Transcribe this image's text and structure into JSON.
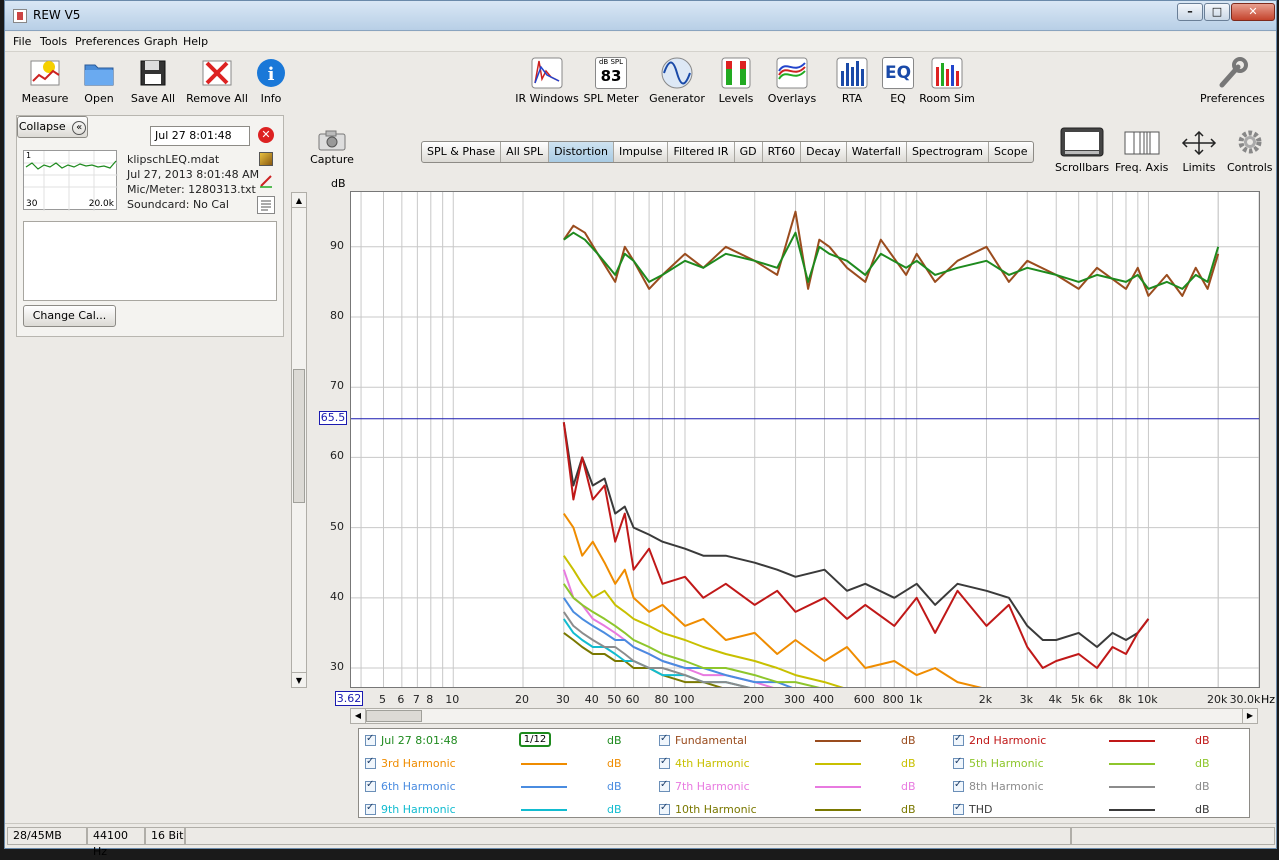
{
  "window": {
    "title": "REW V5"
  },
  "menu": [
    "File",
    "Tools",
    "Preferences",
    "Graph",
    "Help"
  ],
  "toolbar_left": [
    {
      "label": "Measure",
      "icon": "measure-icon"
    },
    {
      "label": "Open",
      "icon": "folder-icon"
    },
    {
      "label": "Save All",
      "icon": "save-icon"
    },
    {
      "label": "Remove All",
      "icon": "remove-icon"
    },
    {
      "label": "Info",
      "icon": "info-icon"
    }
  ],
  "toolbar_center": [
    {
      "label": "IR Windows",
      "icon": "ir-windows-icon"
    },
    {
      "label": "SPL Meter",
      "icon": "spl-meter-icon",
      "small": "dB SPL",
      "value": "83"
    },
    {
      "label": "Generator",
      "icon": "generator-icon"
    },
    {
      "label": "Levels",
      "icon": "levels-icon"
    },
    {
      "label": "Overlays",
      "icon": "overlays-icon"
    },
    {
      "label": "RTA",
      "icon": "rta-icon"
    },
    {
      "label": "EQ",
      "icon": "eq-icon",
      "badge": "EQ"
    },
    {
      "label": "Room Sim",
      "icon": "room-sim-icon"
    }
  ],
  "toolbar_right": {
    "label": "Preferences",
    "icon": "wrench-icon"
  },
  "panel": {
    "collapse_label": "Collapse",
    "selected_measurement": "Jul 27 8:01:48",
    "thumb_x_min": "30",
    "thumb_x_max": "20.0k",
    "thumb_marker": "1",
    "file": "klipschLEQ.mdat",
    "date": "Jul 27, 2013 8:01:48 AM",
    "mic": "Mic/Meter: 1280313.txt",
    "soundcard": "Soundcard: No Cal",
    "change_cal": "Change Cal..."
  },
  "capture_label": "Capture",
  "tabs": [
    "SPL & Phase",
    "All SPL",
    "Distortion",
    "Impulse",
    "Filtered IR",
    "GD",
    "RT60",
    "Decay",
    "Waterfall",
    "Spectrogram",
    "Scope"
  ],
  "active_tab": "Distortion",
  "right_tools": [
    {
      "label": "Scrollbars",
      "icon": "scrollbars-icon"
    },
    {
      "label": "Freq. Axis",
      "icon": "freq-axis-icon"
    },
    {
      "label": "Limits",
      "icon": "limits-icon"
    },
    {
      "label": "Controls",
      "icon": "gear-icon"
    }
  ],
  "chart_data": {
    "type": "line",
    "ylabel": "dB",
    "xunit": "Hz",
    "xscale": "log",
    "xlim": [
      3.62,
      30000
    ],
    "ylim": [
      27.3,
      97.8
    ],
    "y_ticks": [
      "90",
      "80",
      "70",
      "60",
      "50",
      "40",
      "30"
    ],
    "x_ticks": [
      "5",
      "6",
      "7",
      "8",
      "10",
      "20",
      "30",
      "40",
      "50",
      "60",
      "80",
      "100",
      "200",
      "300",
      "400",
      "600",
      "800",
      "1k",
      "2k",
      "3k",
      "4k",
      "5k",
      "6k",
      "8k",
      "10k",
      "20k",
      "30.0k"
    ],
    "x_start_label": "3.62",
    "cursor_y_label": "65.5",
    "cursor_y": 65.5,
    "grid": true,
    "series": [
      {
        "name": "Jul 27 8:01:48",
        "color": "#1e8a1e",
        "x": [
          30,
          33,
          37,
          42,
          50,
          55,
          60,
          70,
          80,
          100,
          120,
          150,
          200,
          250,
          300,
          340,
          380,
          420,
          500,
          600,
          700,
          900,
          1000,
          1200,
          1500,
          2000,
          2500,
          3000,
          4000,
          5000,
          6000,
          8000,
          9000,
          10000,
          12000,
          14000,
          16000,
          18000,
          20000
        ],
        "values": [
          91,
          92,
          91,
          89,
          86,
          89,
          88,
          85,
          86,
          88,
          87,
          89,
          88,
          87,
          92,
          85,
          90,
          89,
          88,
          86,
          89,
          87,
          88,
          86,
          87,
          88,
          86,
          87,
          86,
          85,
          86,
          85,
          86,
          84,
          85,
          84,
          86,
          85,
          90
        ]
      },
      {
        "name": "Fundamental",
        "color": "#9a4c1e",
        "x": [
          30,
          33,
          37,
          42,
          50,
          55,
          60,
          70,
          80,
          100,
          120,
          150,
          200,
          250,
          300,
          340,
          380,
          420,
          500,
          600,
          700,
          900,
          1000,
          1200,
          1500,
          2000,
          2500,
          3000,
          4000,
          5000,
          6000,
          8000,
          9000,
          10000,
          12000,
          14000,
          16000,
          18000,
          20000
        ],
        "values": [
          91,
          93,
          92,
          89,
          85,
          90,
          88,
          84,
          86,
          89,
          87,
          90,
          88,
          86,
          95,
          84,
          91,
          90,
          87,
          85,
          91,
          86,
          89,
          85,
          88,
          90,
          85,
          88,
          86,
          84,
          87,
          84,
          87,
          83,
          86,
          83,
          87,
          84,
          89
        ]
      },
      {
        "name": "2nd Harmonic",
        "color": "#c01818",
        "x": [
          30,
          33,
          36,
          40,
          45,
          50,
          55,
          60,
          70,
          80,
          100,
          120,
          150,
          200,
          250,
          300,
          400,
          500,
          600,
          800,
          1000,
          1200,
          1500,
          2000,
          2500,
          3000,
          3500,
          4000,
          5000,
          6000,
          7000,
          8000,
          9000,
          10000
        ],
        "values": [
          65,
          54,
          60,
          54,
          56,
          48,
          52,
          44,
          47,
          42,
          43,
          40,
          42,
          39,
          41,
          38,
          40,
          37,
          39,
          36,
          40,
          35,
          41,
          36,
          39,
          33,
          30,
          31,
          32,
          30,
          33,
          32,
          35,
          37
        ]
      },
      {
        "name": "3rd Harmonic",
        "color": "#ef8c00",
        "x": [
          30,
          33,
          36,
          40,
          45,
          50,
          55,
          60,
          70,
          80,
          100,
          120,
          150,
          200,
          250,
          300,
          400,
          500,
          600,
          800,
          1000,
          1200,
          1500,
          2000
        ],
        "values": [
          52,
          50,
          46,
          48,
          45,
          42,
          44,
          40,
          38,
          39,
          36,
          37,
          34,
          35,
          32,
          34,
          31,
          33,
          30,
          31,
          29,
          30,
          28,
          27
        ]
      },
      {
        "name": "4th Harmonic",
        "color": "#c8c000",
        "x": [
          30,
          33,
          36,
          40,
          45,
          50,
          55,
          60,
          70,
          80,
          100,
          120,
          150,
          200,
          250,
          300,
          400,
          500
        ],
        "values": [
          46,
          44,
          42,
          40,
          41,
          39,
          38,
          37,
          36,
          35,
          34,
          33,
          32,
          31,
          30,
          29,
          28,
          27
        ]
      },
      {
        "name": "5th Harmonic",
        "color": "#8ec62c",
        "x": [
          30,
          33,
          36,
          40,
          45,
          50,
          55,
          60,
          70,
          80,
          100,
          120,
          150,
          200,
          250,
          300,
          400
        ],
        "values": [
          42,
          40,
          39,
          38,
          37,
          36,
          35,
          34,
          33,
          32,
          31,
          30,
          30,
          29,
          28,
          28,
          27
        ]
      },
      {
        "name": "6th Harmonic",
        "color": "#4a8ce0",
        "x": [
          30,
          33,
          36,
          40,
          45,
          50,
          55,
          60,
          70,
          80,
          100,
          120,
          150,
          200,
          250,
          300
        ],
        "values": [
          40,
          38,
          37,
          36,
          35,
          34,
          34,
          33,
          32,
          31,
          30,
          30,
          29,
          28,
          28,
          27
        ]
      },
      {
        "name": "7th Harmonic",
        "color": "#e87ae0",
        "x": [
          30,
          33,
          36,
          40,
          45,
          50,
          55,
          60,
          70,
          80,
          100,
          120,
          150,
          200,
          250
        ],
        "values": [
          44,
          40,
          39,
          37,
          36,
          35,
          34,
          33,
          32,
          31,
          30,
          29,
          29,
          28,
          27
        ]
      },
      {
        "name": "8th Harmonic",
        "color": "#8c8c8c",
        "x": [
          30,
          33,
          36,
          40,
          45,
          50,
          55,
          60,
          70,
          80,
          100,
          120,
          150,
          200
        ],
        "values": [
          38,
          36,
          35,
          34,
          33,
          33,
          32,
          31,
          30,
          30,
          29,
          28,
          28,
          27
        ]
      },
      {
        "name": "9th Harmonic",
        "color": "#12bcd0",
        "x": [
          30,
          33,
          36,
          40,
          45,
          50,
          55,
          60,
          70,
          80,
          100,
          120,
          150,
          200
        ],
        "values": [
          37,
          35,
          34,
          33,
          33,
          32,
          31,
          31,
          30,
          29,
          29,
          28,
          28,
          27
        ]
      },
      {
        "name": "10th Harmonic",
        "color": "#7a7800",
        "x": [
          30,
          33,
          36,
          40,
          45,
          50,
          55,
          60,
          70,
          80,
          100,
          120,
          150
        ],
        "values": [
          35,
          34,
          33,
          32,
          32,
          31,
          31,
          30,
          30,
          29,
          28,
          28,
          27
        ]
      },
      {
        "name": "THD",
        "color": "#3a3a3a",
        "x": [
          30,
          33,
          36,
          40,
          45,
          50,
          55,
          60,
          70,
          80,
          100,
          120,
          150,
          200,
          250,
          300,
          400,
          500,
          600,
          800,
          1000,
          1200,
          1500,
          2000,
          2500,
          3000,
          3500,
          4000,
          5000,
          6000,
          7000,
          8000,
          9000,
          10000
        ],
        "values": [
          65,
          56,
          60,
          56,
          57,
          52,
          53,
          50,
          49,
          48,
          47,
          46,
          46,
          45,
          44,
          43,
          44,
          41,
          42,
          40,
          42,
          39,
          42,
          41,
          40,
          36,
          34,
          34,
          35,
          33,
          35,
          34,
          35,
          37
        ]
      }
    ]
  },
  "legend": [
    {
      "label": "Jul 27 8:01:48",
      "color": "#1e8a1e",
      "unit": "dB",
      "smoothing": "1/12"
    },
    {
      "label": "Fundamental",
      "color": "#9a4c1e",
      "unit": "dB"
    },
    {
      "label": "2nd Harmonic",
      "color": "#c01818",
      "unit": "dB"
    },
    {
      "label": "3rd Harmonic",
      "color": "#ef8c00",
      "unit": "dB"
    },
    {
      "label": "4th Harmonic",
      "color": "#c8c000",
      "unit": "dB"
    },
    {
      "label": "5th Harmonic",
      "color": "#8ec62c",
      "unit": "dB"
    },
    {
      "label": "6th Harmonic",
      "color": "#4a8ce0",
      "unit": "dB"
    },
    {
      "label": "7th Harmonic",
      "color": "#e87ae0",
      "unit": "dB"
    },
    {
      "label": "8th Harmonic",
      "color": "#8c8c8c",
      "unit": "dB"
    },
    {
      "label": "9th Harmonic",
      "color": "#12bcd0",
      "unit": "dB"
    },
    {
      "label": "10th Harmonic",
      "color": "#7a7800",
      "unit": "dB"
    },
    {
      "label": "THD",
      "color": "#3a3a3a",
      "unit": "dB"
    }
  ],
  "status": {
    "memory": "28/45MB",
    "rate": "44100 Hz",
    "bits": "16 Bit"
  }
}
